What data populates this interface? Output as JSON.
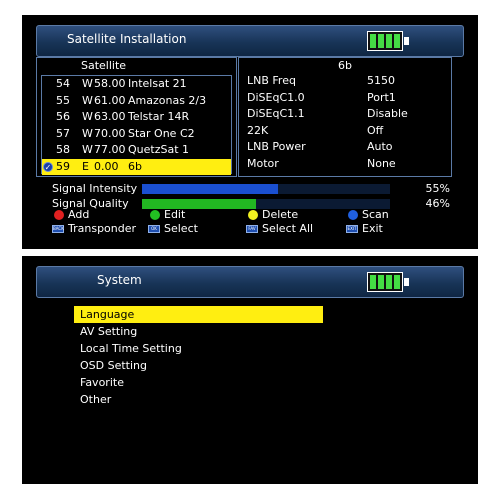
{
  "satellite_screen": {
    "title": "Satellite Installation",
    "list_header": "Satellite",
    "satellites": [
      {
        "num": "54",
        "dir": "W",
        "deg": "58.00",
        "name": "Intelsat 21"
      },
      {
        "num": "55",
        "dir": "W",
        "deg": "61.00",
        "name": "Amazonas 2/3"
      },
      {
        "num": "56",
        "dir": "W",
        "deg": "63.00",
        "name": "Telstar 14R"
      },
      {
        "num": "57",
        "dir": "W",
        "deg": "70.00",
        "name": "Star One C2"
      },
      {
        "num": "58",
        "dir": "W",
        "deg": "77.00",
        "name": "QuetzSat 1"
      },
      {
        "num": "59",
        "dir": "E",
        "deg": "0.00",
        "name": "6b"
      }
    ],
    "selected_index": 5,
    "info": {
      "header": "6b",
      "rows": [
        {
          "label": "LNB Freq",
          "value": "5150"
        },
        {
          "label": "DiSEqC1.0",
          "value": "Port1"
        },
        {
          "label": "DiSEqC1.1",
          "value": "Disable"
        },
        {
          "label": "22K",
          "value": "Off"
        },
        {
          "label": "LNB Power",
          "value": "Auto"
        },
        {
          "label": "Motor",
          "value": "None"
        }
      ]
    },
    "signal_intensity": {
      "label": "Signal Intensity",
      "percent_text": "55%",
      "level": 0.55,
      "color": "#1a4fd0"
    },
    "signal_quality": {
      "label": "Signal Quality",
      "percent_text": "46%",
      "level": 0.46,
      "color": "#22b822"
    },
    "keys": [
      {
        "label": "Add",
        "color": "#e02020"
      },
      {
        "label": "Edit",
        "color": "#22c022"
      },
      {
        "label": "Delete",
        "color": "#f0f020"
      },
      {
        "label": "Scan",
        "color": "#2060e0"
      }
    ],
    "buttons": [
      {
        "icon": "BACK",
        "label": "Transponder"
      },
      {
        "icon": "OK",
        "label": "Select"
      },
      {
        "icon": "FAV",
        "label": "Select All"
      },
      {
        "icon": "EXIT",
        "label": "Exit"
      }
    ]
  },
  "system_screen": {
    "title": "System",
    "menu": [
      "Language",
      "AV Setting",
      "Local Time Setting",
      "OSD Setting",
      "Favorite",
      "Other"
    ],
    "selected_index": 0
  }
}
